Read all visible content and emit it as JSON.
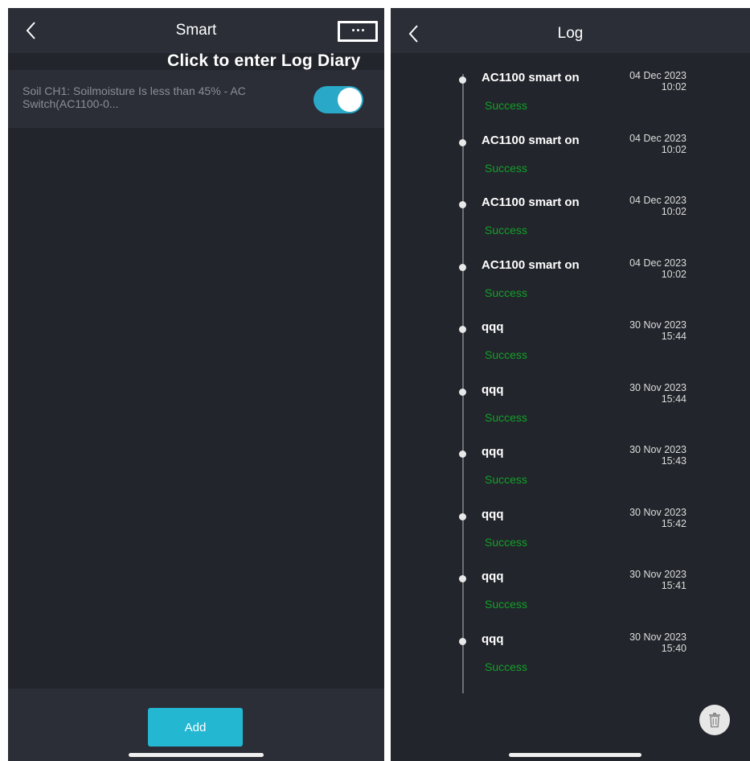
{
  "smart_screen": {
    "title": "Smart",
    "hint": "Click to enter Log Diary",
    "rule": {
      "text": "Soil CH1: Soilmoisture Is less than 45% - AC Switch(AC1100-0...",
      "enabled": true
    },
    "add_label": "Add"
  },
  "log_screen": {
    "title": "Log",
    "entries": [
      {
        "title": "AC1100 smart on",
        "status": "Success",
        "date": "04 Dec 2023",
        "time": "10:02"
      },
      {
        "title": "AC1100 smart on",
        "status": "Success",
        "date": "04 Dec 2023",
        "time": "10:02"
      },
      {
        "title": "AC1100 smart on",
        "status": "Success",
        "date": "04 Dec 2023",
        "time": "10:02"
      },
      {
        "title": "AC1100 smart on",
        "status": "Success",
        "date": "04 Dec 2023",
        "time": "10:02"
      },
      {
        "title": "qqq",
        "status": "Success",
        "date": "30 Nov 2023",
        "time": "15:44"
      },
      {
        "title": "qqq",
        "status": "Success",
        "date": "30 Nov 2023",
        "time": "15:44"
      },
      {
        "title": "qqq",
        "status": "Success",
        "date": "30 Nov 2023",
        "time": "15:43"
      },
      {
        "title": "qqq",
        "status": "Success",
        "date": "30 Nov 2023",
        "time": "15:42"
      },
      {
        "title": "qqq",
        "status": "Success",
        "date": "30 Nov 2023",
        "time": "15:41"
      },
      {
        "title": "qqq",
        "status": "Success",
        "date": "30 Nov 2023",
        "time": "15:40"
      }
    ]
  },
  "icons": {
    "back": "chevron-left-icon",
    "more": "more-horizontal-icon",
    "trash": "trash-icon"
  },
  "colors": {
    "background": "#22252b",
    "surface": "#2b2e36",
    "accent": "#24b7d2",
    "toggle_on": "#2aa8c7",
    "success": "#14a02a"
  }
}
